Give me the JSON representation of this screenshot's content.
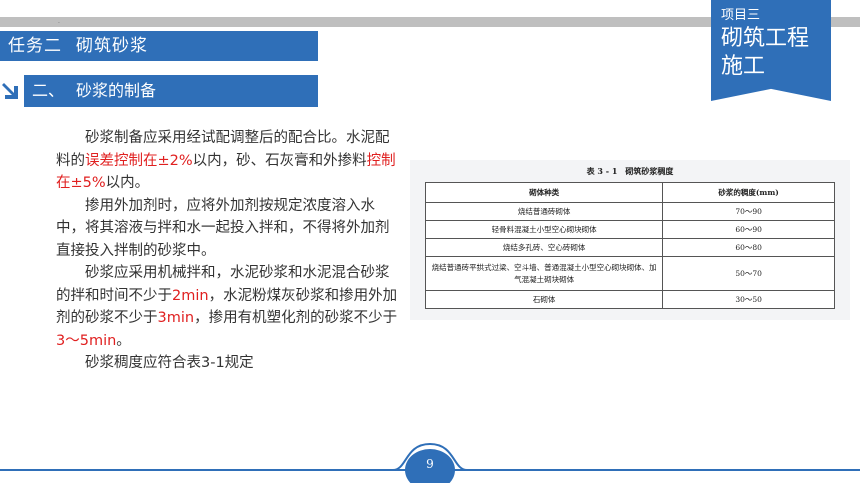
{
  "header": {
    "task_label": "任务二",
    "task_title": "砌筑砂浆",
    "project_label": "项目三",
    "project_title": "砌筑工程施工"
  },
  "section": {
    "number": "二、",
    "title": "砂浆的制备"
  },
  "body": {
    "p1_a": "砂浆制备应采用经试配调整后的配合比。水泥配料的",
    "p1_red1": "误差控制在±2%",
    "p1_b": "以内，砂、石灰膏和外掺料",
    "p1_red2": "控制在±5%",
    "p1_c": "以内。",
    "p2": "掺用外加剂时，应将外加剂按规定浓度溶入水中，将其溶液与拌和水一起投入拌和，不得将外加剂直接投入拌制的砂浆中。",
    "p3_a": "砂浆应采用机械拌和，水泥砂浆和水泥混合砂浆的拌和时间不少于",
    "p3_red1": "2min",
    "p3_b": "，水泥粉煤灰砂浆和掺用外加剂的砂浆不少于",
    "p3_red2": "3min",
    "p3_c": "，掺用有机塑化剂的砂浆不少于",
    "p3_red3": "3～5min",
    "p3_d": "。",
    "p4": "砂浆稠度应符合表3-1规定"
  },
  "table": {
    "title": "表 3 - 1　砌筑砂浆稠度",
    "headers": [
      "砌体种类",
      "砂浆的稠度(mm)"
    ],
    "rows": [
      [
        "烧结普通砖砌体",
        "70～90"
      ],
      [
        "轻骨料混凝土小型空心砌块砌体",
        "60～90"
      ],
      [
        "烧结多孔砖、空心砖砌体",
        "60～80"
      ],
      [
        "烧结普通砖平拱式过梁、空斗墙、普通混凝土小型空心砌块砌体、加气混凝土砌块砌体",
        "50～70"
      ],
      [
        "石砌体",
        "30～50"
      ]
    ]
  },
  "footer": {
    "page_number": "9"
  },
  "colors": {
    "accent": "#2f6fb8",
    "highlight": "#e02020"
  }
}
